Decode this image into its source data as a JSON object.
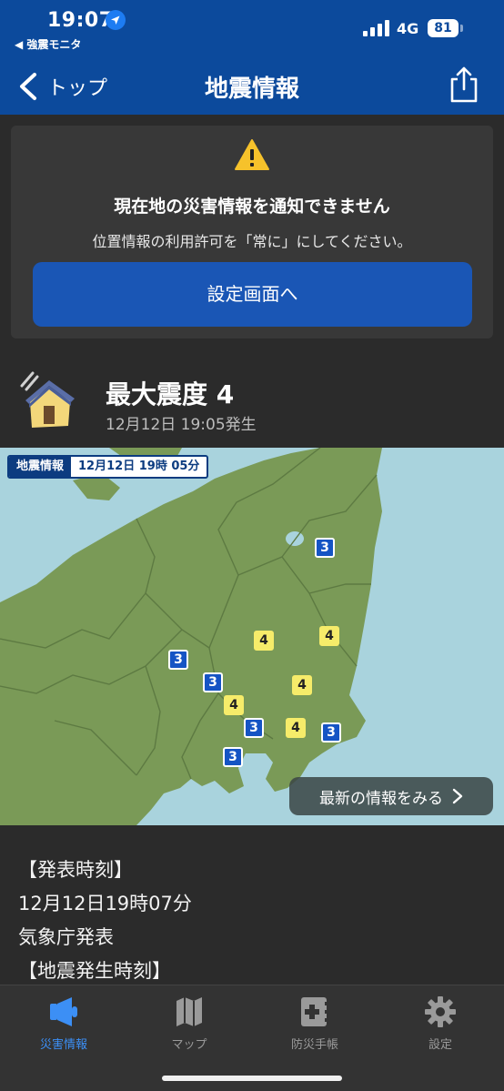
{
  "status_bar": {
    "time": "19:07",
    "back_app": "◀ 強震モニタ",
    "network": "4G",
    "battery": "81"
  },
  "nav": {
    "back_label": "トップ",
    "title": "地震情報",
    "share_icon": "share-icon",
    "bg_color": "#0c4a9c"
  },
  "warning": {
    "title": "現在地の災害情報を通知できません",
    "text": "位置情報の利用許可を「常に」にしてください。",
    "button_label": "設定画面へ"
  },
  "intensity": {
    "max_label": "最大震度 4",
    "occurred": "12月12日 19:05発生"
  },
  "map": {
    "badge_label": "地震情報",
    "badge_time": "12月12日 19時 05分",
    "markers": [
      {
        "value": "3",
        "level": 3
      },
      {
        "value": "4",
        "level": 4
      },
      {
        "value": "4",
        "level": 4
      },
      {
        "value": "3",
        "level": 3
      },
      {
        "value": "3",
        "level": 3
      },
      {
        "value": "4",
        "level": 4
      },
      {
        "value": "4",
        "level": 4
      },
      {
        "value": "3",
        "level": 3
      },
      {
        "value": "4",
        "level": 4
      },
      {
        "value": "3",
        "level": 3
      },
      {
        "value": "3",
        "level": 3
      }
    ],
    "latest_button": "最新の情報をみる",
    "colors": {
      "sea": "#a9d3dd",
      "land": "#7a9a57",
      "intensity_3": "#1554c4",
      "intensity_4": "#f6ec6a"
    }
  },
  "report": {
    "lines": [
      "【発表時刻】",
      "12月12日19時07分",
      "気象庁発表",
      "【地震発生時刻】"
    ]
  },
  "tabs": [
    {
      "label": "災害情報",
      "icon": "megaphone-icon",
      "active": true
    },
    {
      "label": "マップ",
      "icon": "map-icon",
      "active": false
    },
    {
      "label": "防災手帳",
      "icon": "handbook-icon",
      "active": false
    },
    {
      "label": "設定",
      "icon": "gear-icon",
      "active": false
    }
  ]
}
